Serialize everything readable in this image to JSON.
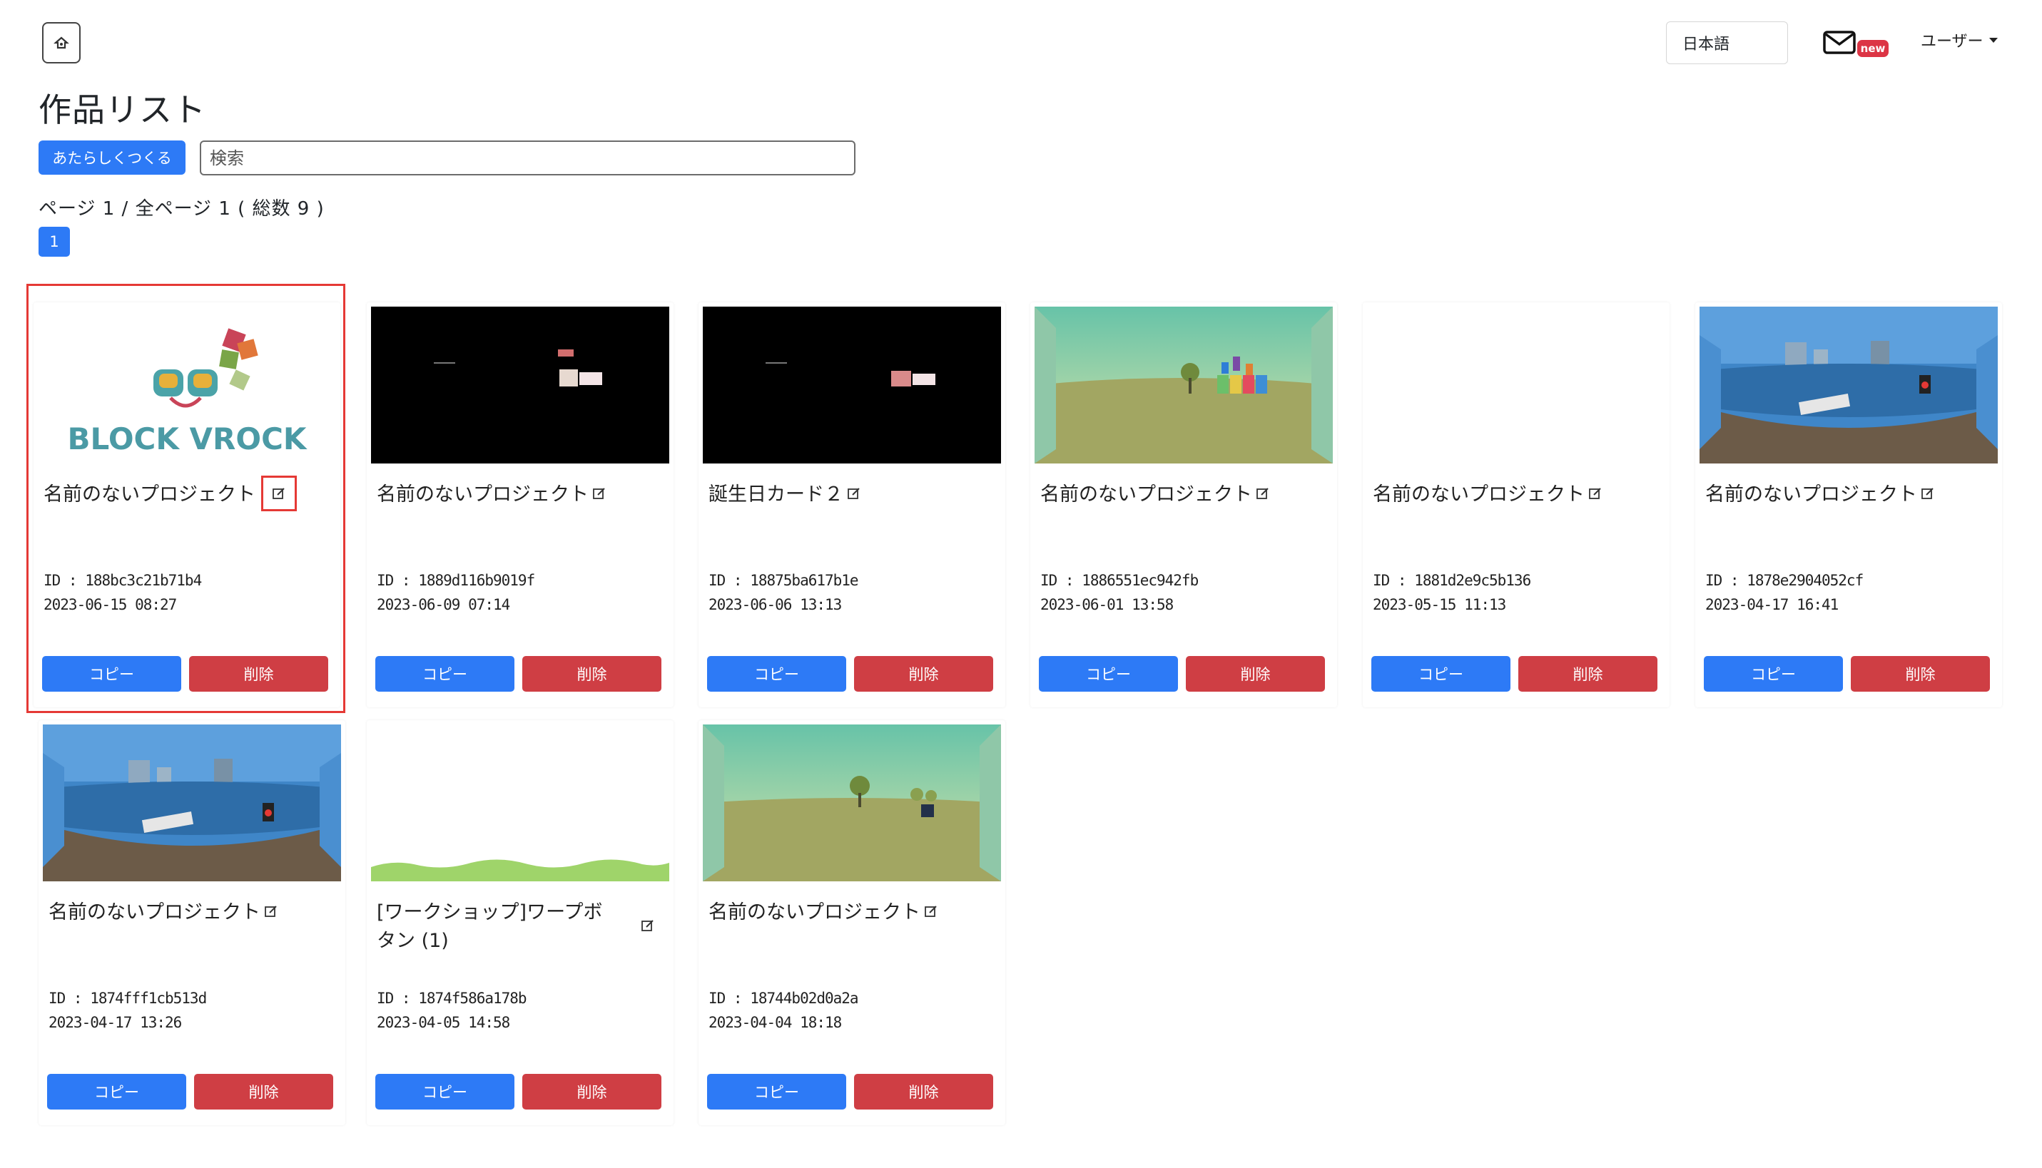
{
  "header": {
    "language": "日本語",
    "mail_badge": "new",
    "user_menu": "ユーザー"
  },
  "main": {
    "title": "作品リスト",
    "new_button": "あたらしくつくる",
    "search_placeholder": "検索",
    "page_info": "ページ 1 / 全ページ 1 ( 総数 9 )",
    "current_page": "1"
  },
  "projects": [
    {
      "title": "名前のないプロジェクト",
      "id": "ID : 188bc3c21b71b4",
      "date": "2023-06-15 08:27",
      "copy": "コピー",
      "delete": "削除",
      "thumb": "block-vrock-logo",
      "logo_text": "BLOCK VROCK"
    },
    {
      "title": "名前のないプロジェクト",
      "id": "ID : 1889d116b9019f",
      "date": "2023-06-09 07:14",
      "copy": "コピー",
      "delete": "削除",
      "thumb": "dark-scene"
    },
    {
      "title": "誕生日カード２",
      "id": "ID : 18875ba617b1e",
      "date": "2023-06-06 13:13",
      "copy": "コピー",
      "delete": "削除",
      "thumb": "dark-scene-2"
    },
    {
      "title": "名前のないプロジェクト",
      "id": "ID : 1886551ec942fb",
      "date": "2023-06-01 13:58",
      "copy": "コピー",
      "delete": "削除",
      "thumb": "green-field-happy"
    },
    {
      "title": "名前のないプロジェクト",
      "id": "ID : 1881d2e9c5b136",
      "date": "2023-05-15 11:13",
      "copy": "コピー",
      "delete": "削除",
      "thumb": "blank"
    },
    {
      "title": "名前のないプロジェクト",
      "id": "ID : 1878e2904052cf",
      "date": "2023-04-17 16:41",
      "copy": "コピー",
      "delete": "削除",
      "thumb": "river-panorama"
    },
    {
      "title": "名前のないプロジェクト",
      "id": "ID : 1874fff1cb513d",
      "date": "2023-04-17 13:26",
      "copy": "コピー",
      "delete": "削除",
      "thumb": "river-panorama"
    },
    {
      "title": "[ワークショップ]ワープボタン (1)",
      "id": "ID : 1874f586a178b",
      "date": "2023-04-05 14:58",
      "copy": "コピー",
      "delete": "削除",
      "thumb": "green-wave"
    },
    {
      "title": "名前のないプロジェクト",
      "id": "ID : 18744b02d0a2a",
      "date": "2023-04-04 18:18",
      "copy": "コピー",
      "delete": "削除",
      "thumb": "green-field"
    }
  ],
  "colors": {
    "primary": "#2d7af6",
    "danger": "#cf3e44",
    "highlight": "#e53935"
  }
}
